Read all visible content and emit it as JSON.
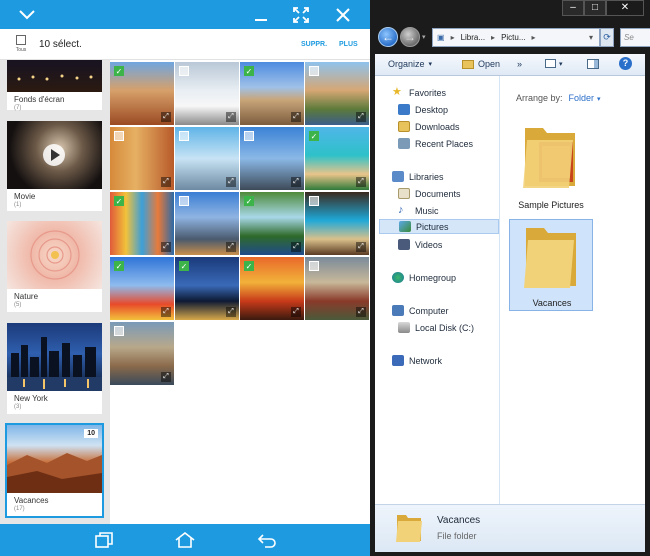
{
  "android": {
    "selection": {
      "select_all_label": "Tous",
      "count_label": "10 sélect.",
      "delete_label": "SUPPR.",
      "more_label": "PLUS"
    },
    "albums": [
      {
        "name": "Fonds d'écran",
        "count": "(7)"
      },
      {
        "name": "Movie",
        "count": "(1)"
      },
      {
        "name": "Nature",
        "count": "(5)"
      },
      {
        "name": "New York",
        "count": "(3)"
      },
      {
        "name": "Vacances",
        "count": "(17)",
        "badge": "10"
      }
    ],
    "photos_checked": [
      true,
      false,
      true,
      false,
      false,
      false,
      false,
      true,
      true,
      false,
      true,
      false,
      true,
      true,
      true,
      false,
      false
    ]
  },
  "explorer": {
    "path": [
      "Libra...",
      "Pictu..."
    ],
    "search_placeholder": "Se",
    "toolbar": {
      "organize": "Organize",
      "open": "Open"
    },
    "nav": {
      "favorites": "Favorites",
      "desktop": "Desktop",
      "downloads": "Downloads",
      "recent": "Recent Places",
      "libraries": "Libraries",
      "documents": "Documents",
      "music": "Music",
      "pictures": "Pictures",
      "videos": "Videos",
      "homegroup": "Homegroup",
      "computer": "Computer",
      "local_disk": "Local Disk (C:)",
      "network": "Network"
    },
    "arrange_label": "Arrange by:",
    "arrange_value": "Folder",
    "folders": [
      "Sample Pictures",
      "Vacances"
    ],
    "status": {
      "name": "Vacances",
      "type": "File folder"
    }
  }
}
